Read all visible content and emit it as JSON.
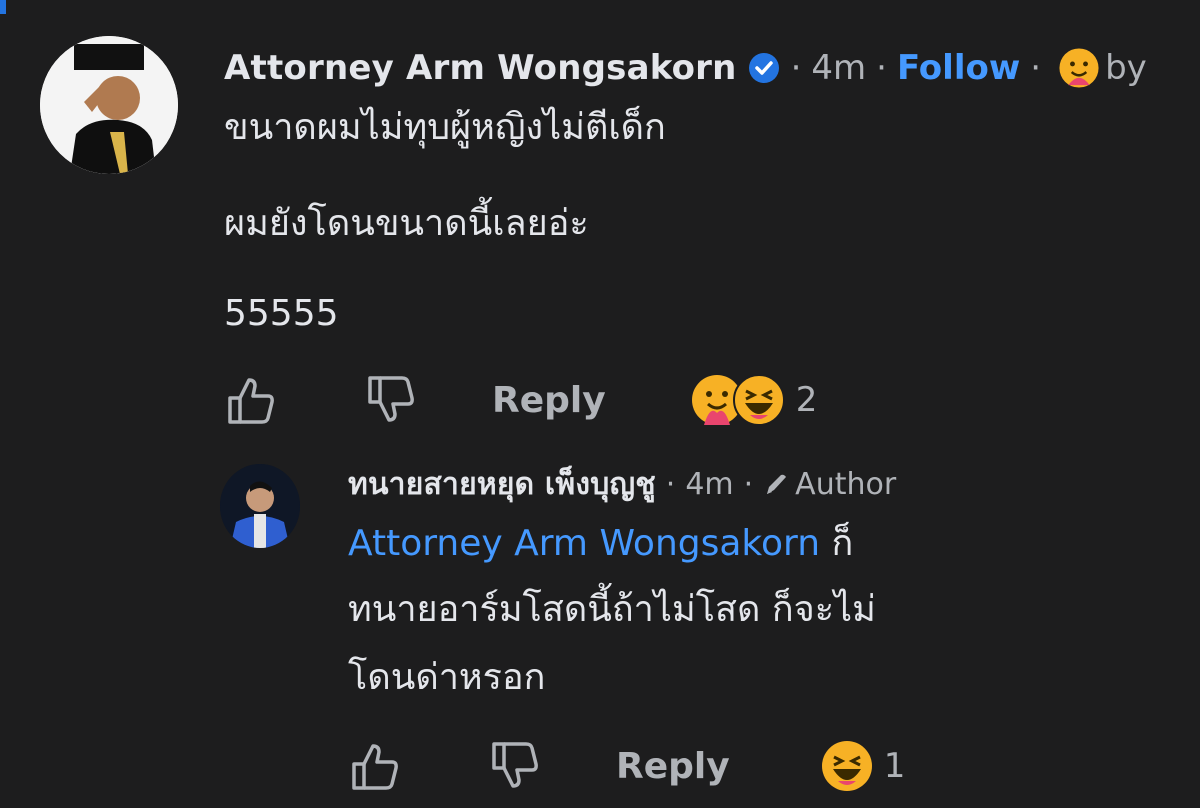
{
  "comment": {
    "author": "Attorney Arm Wongsakorn",
    "time": "4m",
    "sep": "·",
    "follow_label": "Follow",
    "by_fragment": "by",
    "lines": [
      "ขนาดผมไม่ทุบผู้หญิงไม่ตีเด็ก",
      "ผมยังโดนขนาดนี้เลยอ่ะ",
      "55555"
    ],
    "reply_label": "Reply",
    "reaction_count": "2",
    "reactions": [
      "care-emoji",
      "haha-emoji"
    ]
  },
  "reply": {
    "author": "ทนายสายหยุด เพ็งบุญชู",
    "time": "4m",
    "sep": "·",
    "badge_label": "Author",
    "mention": "Attorney Arm Wongsakorn",
    "line1_tail": "ก็",
    "line2": "ทนายอาร์มโสดนี้ถ้าไม่โสด ก็จะไม่",
    "line3": "โดนด่าหรอก",
    "reply_label": "Reply",
    "reaction_count": "1",
    "reactions": [
      "haha-emoji"
    ]
  },
  "colors": {
    "background": "#1d1d1e",
    "link": "#4599ff",
    "muted": "#b0b3b8",
    "text": "#e4e6eb",
    "verified": "#2374e1"
  }
}
